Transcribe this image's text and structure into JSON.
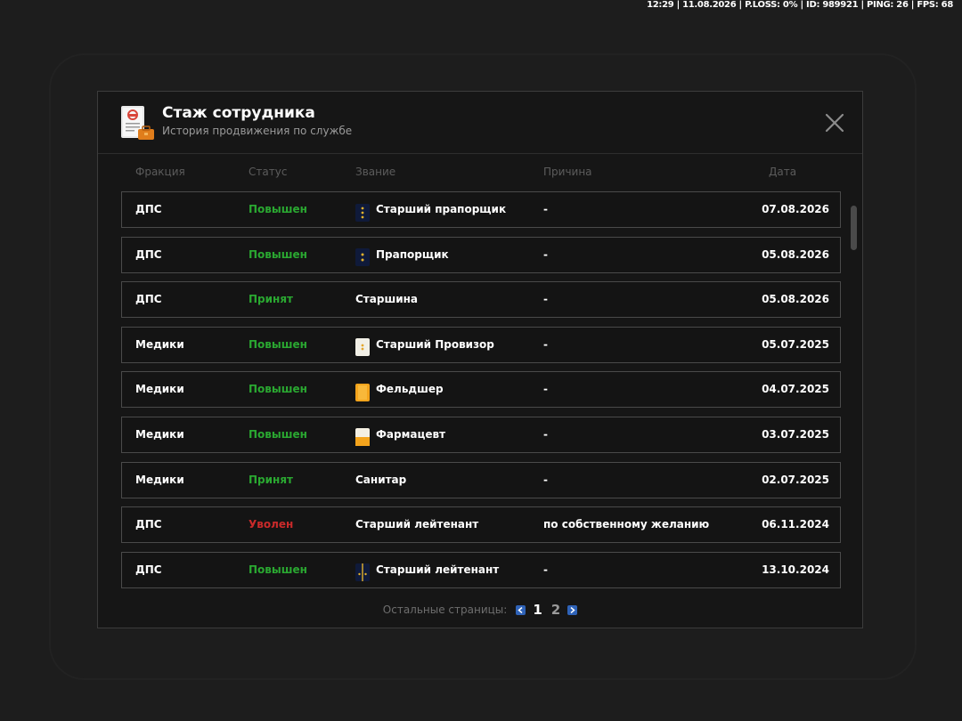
{
  "hud": {
    "text": "12:29 | 11.08.2026 | P.LOSS: 0% | ID: 989921 | PING: 26 | FPS: 68"
  },
  "modal": {
    "title": "Стаж сотрудника",
    "subtitle": "История продвижения по службе",
    "header_icon": "document-briefcase-icon",
    "close_icon": "close-icon"
  },
  "columns": {
    "faction": "Фракция",
    "status": "Статус",
    "rank": "Звание",
    "reason": "Причина",
    "date": "Дата"
  },
  "rows": [
    {
      "faction": "ДПС",
      "status": "Повышен",
      "status_color": "#2aa831",
      "rank": "Старший прапорщик",
      "rank_icon": "insignia-navy-three-stars-icon",
      "reason": "-",
      "date": "07.08.2026"
    },
    {
      "faction": "ДПС",
      "status": "Повышен",
      "status_color": "#2aa831",
      "rank": "Прапорщик",
      "rank_icon": "insignia-navy-two-stars-icon",
      "reason": "-",
      "date": "05.08.2026"
    },
    {
      "faction": "ДПС",
      "status": "Принят",
      "status_color": "#2aa831",
      "rank": "Старшина",
      "rank_icon": "",
      "reason": "-",
      "date": "05.08.2026"
    },
    {
      "faction": "Медики",
      "status": "Повышен",
      "status_color": "#2aa831",
      "rank": "Старший Провизор",
      "rank_icon": "insignia-white-gold-icon",
      "reason": "-",
      "date": "05.07.2025"
    },
    {
      "faction": "Медики",
      "status": "Повышен",
      "status_color": "#2aa831",
      "rank": "Фельдшер",
      "rank_icon": "insignia-orange-icon",
      "reason": "-",
      "date": "04.07.2025"
    },
    {
      "faction": "Медики",
      "status": "Повышен",
      "status_color": "#2aa831",
      "rank": "Фармацевт",
      "rank_icon": "insignia-white-orange-icon",
      "reason": "-",
      "date": "03.07.2025"
    },
    {
      "faction": "Медики",
      "status": "Принят",
      "status_color": "#2aa831",
      "rank": "Санитар",
      "rank_icon": "",
      "reason": "-",
      "date": "02.07.2025"
    },
    {
      "faction": "ДПС",
      "status": "Уволен",
      "status_color": "#c92a2a",
      "rank": "Старший лейтенант",
      "rank_icon": "",
      "reason": "по собственному желанию",
      "date": "06.11.2024"
    },
    {
      "faction": "ДПС",
      "status": "Повышен",
      "status_color": "#2aa831",
      "rank": "Старший лейтенант",
      "rank_icon": "insignia-navy-stripe-stars-icon",
      "reason": "-",
      "date": "13.10.2024"
    }
  ],
  "pagination": {
    "label": "Остальные страницы:",
    "pages": [
      "1",
      "2"
    ],
    "current": "1",
    "prev_icon": "chevron-left-icon",
    "next_icon": "chevron-right-icon"
  },
  "colors": {
    "status_green": "#2aa831",
    "status_red": "#c92a2a",
    "pager_accent": "#2f63b8"
  }
}
